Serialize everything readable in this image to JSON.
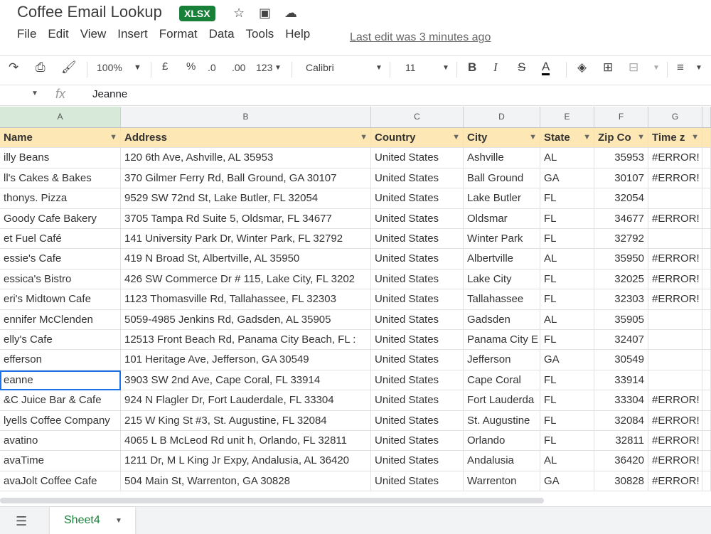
{
  "doc": {
    "title": "Coffee Email Lookup",
    "badge": "XLSX",
    "last_edit": "Last edit was 3 minutes ago"
  },
  "menu": [
    "File",
    "Edit",
    "View",
    "Insert",
    "Format",
    "Data",
    "Tools",
    "Help"
  ],
  "toolbar": {
    "zoom": "100%",
    "currency": "£",
    "percent": "%",
    "dec_less": ".0",
    "dec_more": ".00",
    "format": "123",
    "font": "Calibri",
    "size": "11"
  },
  "formula": {
    "value": "Jeanne"
  },
  "columns": [
    "A",
    "B",
    "C",
    "D",
    "E",
    "F",
    "G"
  ],
  "headers": [
    "Name",
    "Address",
    "Country",
    "City",
    "State",
    "Zip Co",
    "Time z"
  ],
  "rows": [
    [
      "illy Beans",
      "120 6th Ave, Ashville, AL 35953",
      "United States",
      "Ashville",
      "AL",
      "35953",
      "#ERROR!"
    ],
    [
      "ll's Cakes & Bakes",
      "370 Gilmer Ferry Rd, Ball Ground, GA 30107",
      "United States",
      "Ball Ground",
      "GA",
      "30107",
      "#ERROR!"
    ],
    [
      "thonys. Pizza",
      "9529 SW 72nd St, Lake Butler, FL 32054",
      "United States",
      "Lake Butler",
      "FL",
      "32054",
      ""
    ],
    [
      "Goody Cafe Bakery",
      "3705 Tampa Rd Suite 5, Oldsmar, FL 34677",
      "United States",
      "Oldsmar",
      "FL",
      "34677",
      "#ERROR!"
    ],
    [
      "et Fuel Café",
      "141 University Park Dr, Winter Park, FL 32792",
      "United States",
      "Winter Park",
      "FL",
      "32792",
      ""
    ],
    [
      "essie's Cafe",
      "419 N Broad St, Albertville, AL 35950",
      "United States",
      "Albertville",
      "AL",
      "35950",
      "#ERROR!"
    ],
    [
      "essica's Bistro",
      "426 SW Commerce Dr # 115, Lake City, FL 3202",
      "United States",
      "Lake City",
      "FL",
      "32025",
      "#ERROR!"
    ],
    [
      "eri's Midtown Cafe",
      "1123 Thomasville Rd, Tallahassee, FL 32303",
      "United States",
      "Tallahassee",
      "FL",
      "32303",
      "#ERROR!"
    ],
    [
      "ennifer McClenden",
      "5059-4985 Jenkins Rd, Gadsden, AL 35905",
      "United States",
      "Gadsden",
      "AL",
      "35905",
      ""
    ],
    [
      "elly's Cafe",
      "12513 Front Beach Rd, Panama City Beach, FL :",
      "United States",
      "Panama City E",
      "FL",
      "32407",
      ""
    ],
    [
      "efferson",
      "101 Heritage Ave, Jefferson, GA 30549",
      "United States",
      "Jefferson",
      "GA",
      "30549",
      ""
    ],
    [
      "eanne",
      "3903 SW 2nd Ave, Cape Coral, FL 33914",
      "United States",
      "Cape Coral",
      "FL",
      "33914",
      ""
    ],
    [
      "&C Juice Bar & Cafe",
      "924 N Flagler Dr, Fort Lauderdale, FL 33304",
      "United States",
      "Fort Lauderda",
      "FL",
      "33304",
      "#ERROR!"
    ],
    [
      "lyells Coffee Company",
      "215 W King St #3, St. Augustine, FL 32084",
      "United States",
      "St. Augustine",
      "FL",
      "32084",
      "#ERROR!"
    ],
    [
      "avatino",
      "4065 L B McLeod Rd unit h, Orlando, FL 32811",
      "United States",
      "Orlando",
      "FL",
      "32811",
      "#ERROR!"
    ],
    [
      "avaTime",
      "1211 Dr, M L King Jr Expy, Andalusia, AL 36420",
      "United States",
      "Andalusia",
      "AL",
      "36420",
      "#ERROR!"
    ],
    [
      "avaJolt Coffee Cafe",
      "504 Main St, Warrenton, GA 30828",
      "United States",
      "Warrenton",
      "GA",
      "30828",
      "#ERROR!"
    ]
  ],
  "sheet": {
    "name": "Sheet4"
  }
}
